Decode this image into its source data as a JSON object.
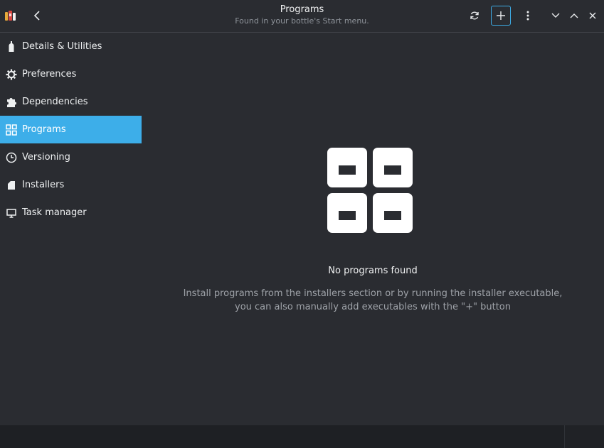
{
  "header": {
    "title": "Programs",
    "subtitle": "Found in your bottle's Start menu.",
    "icons": [
      "app-logo-icon",
      "back-arrow-icon",
      "refresh-icon",
      "add-icon",
      "menu-kebab-icon",
      "minimize-icon",
      "maximize-icon",
      "close-icon"
    ]
  },
  "sidebar": {
    "items": [
      {
        "label": "Details & Utilities",
        "icon": "bottle-icon"
      },
      {
        "label": "Preferences",
        "icon": "gear-icon"
      },
      {
        "label": "Dependencies",
        "icon": "puzzle-icon"
      },
      {
        "label": "Programs",
        "icon": "grid-icon",
        "active": true
      },
      {
        "label": "Versioning",
        "icon": "clock-icon"
      },
      {
        "label": "Installers",
        "icon": "package-icon"
      },
      {
        "label": "Task manager",
        "icon": "monitor-icon"
      }
    ]
  },
  "main": {
    "empty_title": "No programs found",
    "empty_desc_line1": "Install programs from the installers section or by running the installer executable,",
    "empty_desc_line2": "you can also manually add executables with the \"+\" button"
  },
  "colors": {
    "accent": "#3daee9",
    "background": "#2a2c31",
    "text": "#eef0f1",
    "muted": "#9ea2a8"
  }
}
